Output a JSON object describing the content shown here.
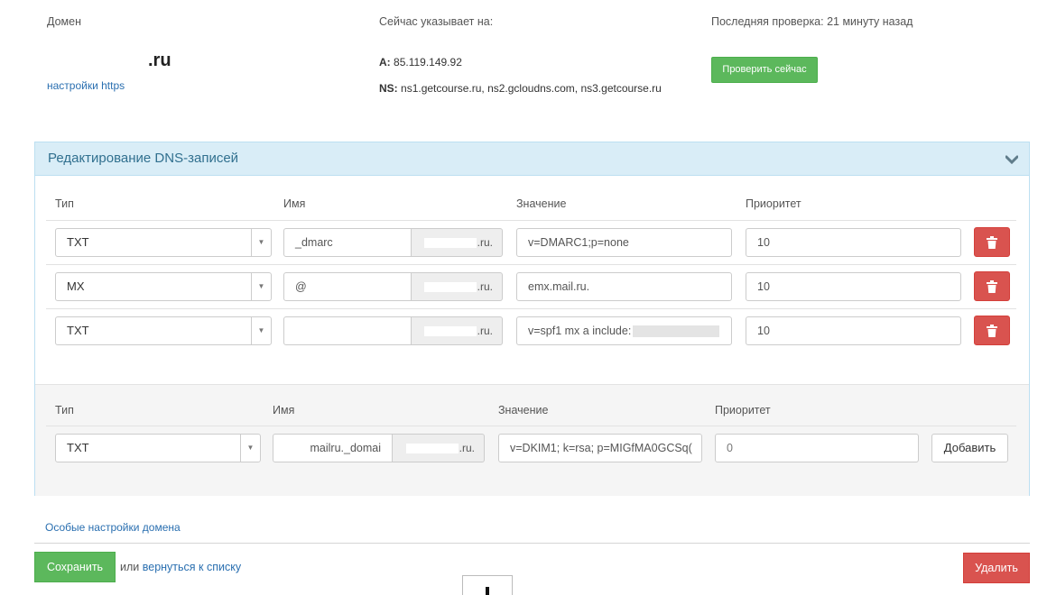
{
  "domain": {
    "label": "Домен",
    "name": ".ru",
    "https_link": "настройки https"
  },
  "pointing": {
    "label": "Сейчас указывает на:",
    "a_key": "A:",
    "a_value": "85.119.149.92",
    "ns_key": "NS:",
    "ns_value": "ns1.getcourse.ru, ns2.gcloudns.com, ns3.getcourse.ru"
  },
  "check": {
    "last_check": "Последняя проверка: 21 минуту назад",
    "button": "Проверить сейчас"
  },
  "panel": {
    "title": "Редактирование DNS-записей",
    "columns": {
      "type": "Тип",
      "name": "Имя",
      "value": "Значение",
      "priority": "Приоритет"
    },
    "records": [
      {
        "type": "TXT",
        "name": "_dmarc",
        "suffix": ".ru.",
        "value": "v=DMARC1;p=none",
        "priority": "10"
      },
      {
        "type": "MX",
        "name": "@",
        "suffix": ".ru.",
        "value": "emx.mail.ru.",
        "priority": "10"
      },
      {
        "type": "TXT",
        "name": "",
        "suffix": ".ru.",
        "value": "v=spf1 mx a include:",
        "priority": "10"
      }
    ],
    "new_record": {
      "type": "TXT",
      "name": "mailru._domai",
      "suffix": ".ru.",
      "value": "v=DKIM1; k=rsa; p=MIGfMA0GCSq(",
      "priority_placeholder": "0",
      "add_button": "Добавить"
    }
  },
  "special_settings_link": "Особые настройки домена",
  "footer": {
    "save_button": "Сохранить",
    "or_text": "или",
    "back_link": "вернуться к списку",
    "delete_button": "Удалить"
  },
  "colors": {
    "green": "#5cb85c",
    "red": "#d9534f",
    "panel_head": "#d9edf7",
    "link": "#2a6fb0"
  }
}
